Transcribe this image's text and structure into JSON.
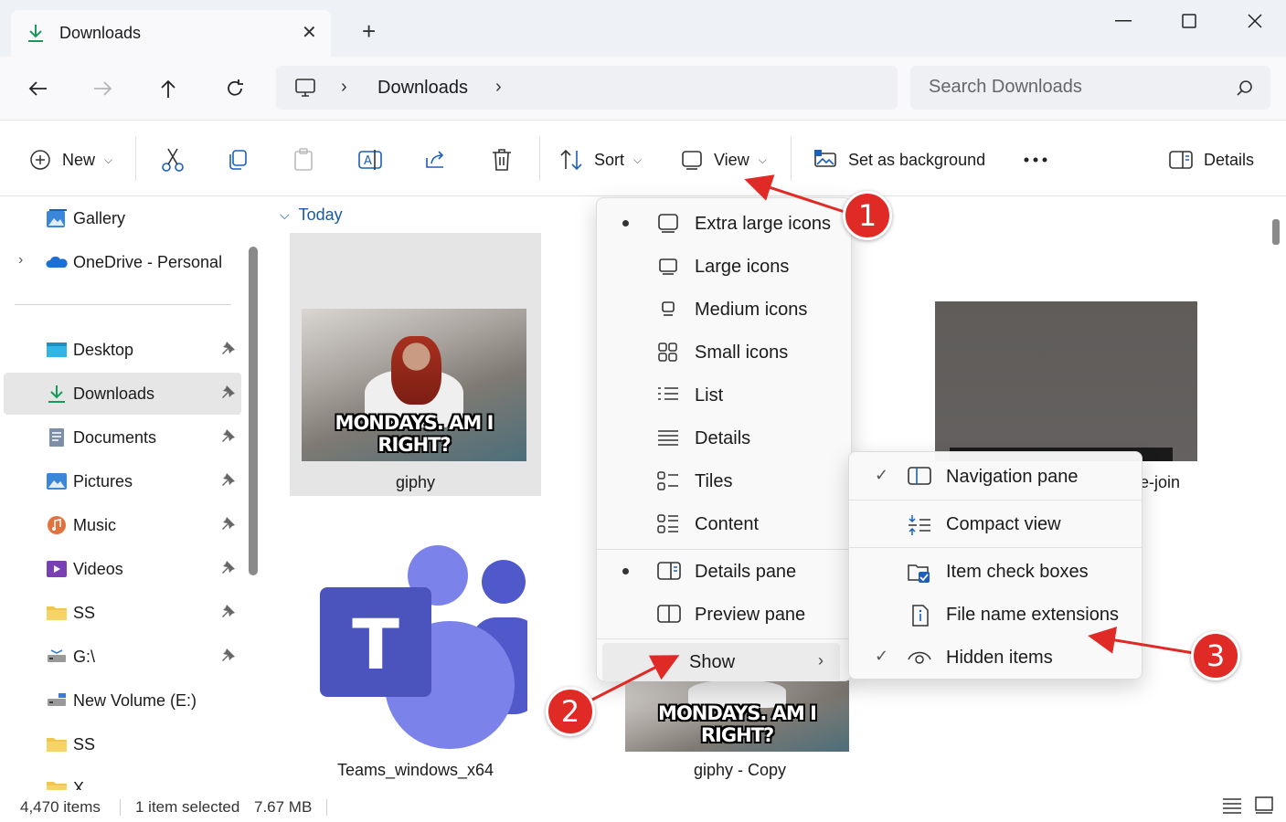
{
  "window": {
    "tab_title": "Downloads",
    "tab_icon": "download-arrow-icon"
  },
  "address_bar": {
    "breadcrumb": "Downloads",
    "search_placeholder": "Search Downloads"
  },
  "command_bar": {
    "new_label": "New",
    "sort_label": "Sort",
    "view_label": "View",
    "set_background_label": "Set as background",
    "details_label": "Details"
  },
  "nav_pane": {
    "items": [
      {
        "label": "Gallery",
        "icon": "gallery-icon"
      },
      {
        "label": "OneDrive - Personal",
        "icon": "onedrive-icon"
      },
      {
        "label": "Desktop",
        "icon": "desktop-folder-icon"
      },
      {
        "label": "Downloads",
        "icon": "downloads-folder-icon"
      },
      {
        "label": "Documents",
        "icon": "documents-folder-icon"
      },
      {
        "label": "Pictures",
        "icon": "pictures-folder-icon"
      },
      {
        "label": "Music",
        "icon": "music-folder-icon"
      },
      {
        "label": "Videos",
        "icon": "videos-folder-icon"
      },
      {
        "label": "SS",
        "icon": "folder-icon"
      },
      {
        "label": "G:\\",
        "icon": "drive-icon"
      },
      {
        "label": "New Volume (E:)",
        "icon": "drive-icon"
      },
      {
        "label": "SS",
        "icon": "folder-icon"
      },
      {
        "label": "X",
        "icon": "folder-icon"
      }
    ]
  },
  "content": {
    "group_header": "Today",
    "files": [
      {
        "name": "giphy",
        "caption": "MONDAYS. AM I RIGHT?"
      },
      {
        "name": "Teams_windows_x64",
        "letter": "T"
      },
      {
        "name": "giphy - Copy",
        "caption": "MONDAYS. AM I RIGHT?"
      }
    ],
    "partial_file_name": "e-join"
  },
  "view_menu": {
    "items": [
      {
        "label": "Extra large icons",
        "selected": true
      },
      {
        "label": "Large icons",
        "selected": false
      },
      {
        "label": "Medium icons",
        "selected": false
      },
      {
        "label": "Small icons",
        "selected": false
      },
      {
        "label": "List",
        "selected": false
      },
      {
        "label": "Details",
        "selected": false
      },
      {
        "label": "Tiles",
        "selected": false
      },
      {
        "label": "Content",
        "selected": false
      }
    ],
    "panes": [
      {
        "label": "Details pane",
        "selected": true
      },
      {
        "label": "Preview pane",
        "selected": false
      }
    ],
    "show_label": "Show"
  },
  "show_menu": {
    "items": [
      {
        "label": "Navigation pane",
        "checked": true
      },
      {
        "label": "Compact view",
        "checked": false
      },
      {
        "label": "Item check boxes",
        "checked": false
      },
      {
        "label": "File name extensions",
        "checked": false
      },
      {
        "label": "Hidden items",
        "checked": true
      }
    ]
  },
  "status_bar": {
    "item_count": "4,470 items",
    "selection": "1 item selected",
    "size": "7.67 MB"
  },
  "annotations": {
    "markers": [
      "1",
      "2",
      "3"
    ],
    "color": "#e02a25"
  }
}
